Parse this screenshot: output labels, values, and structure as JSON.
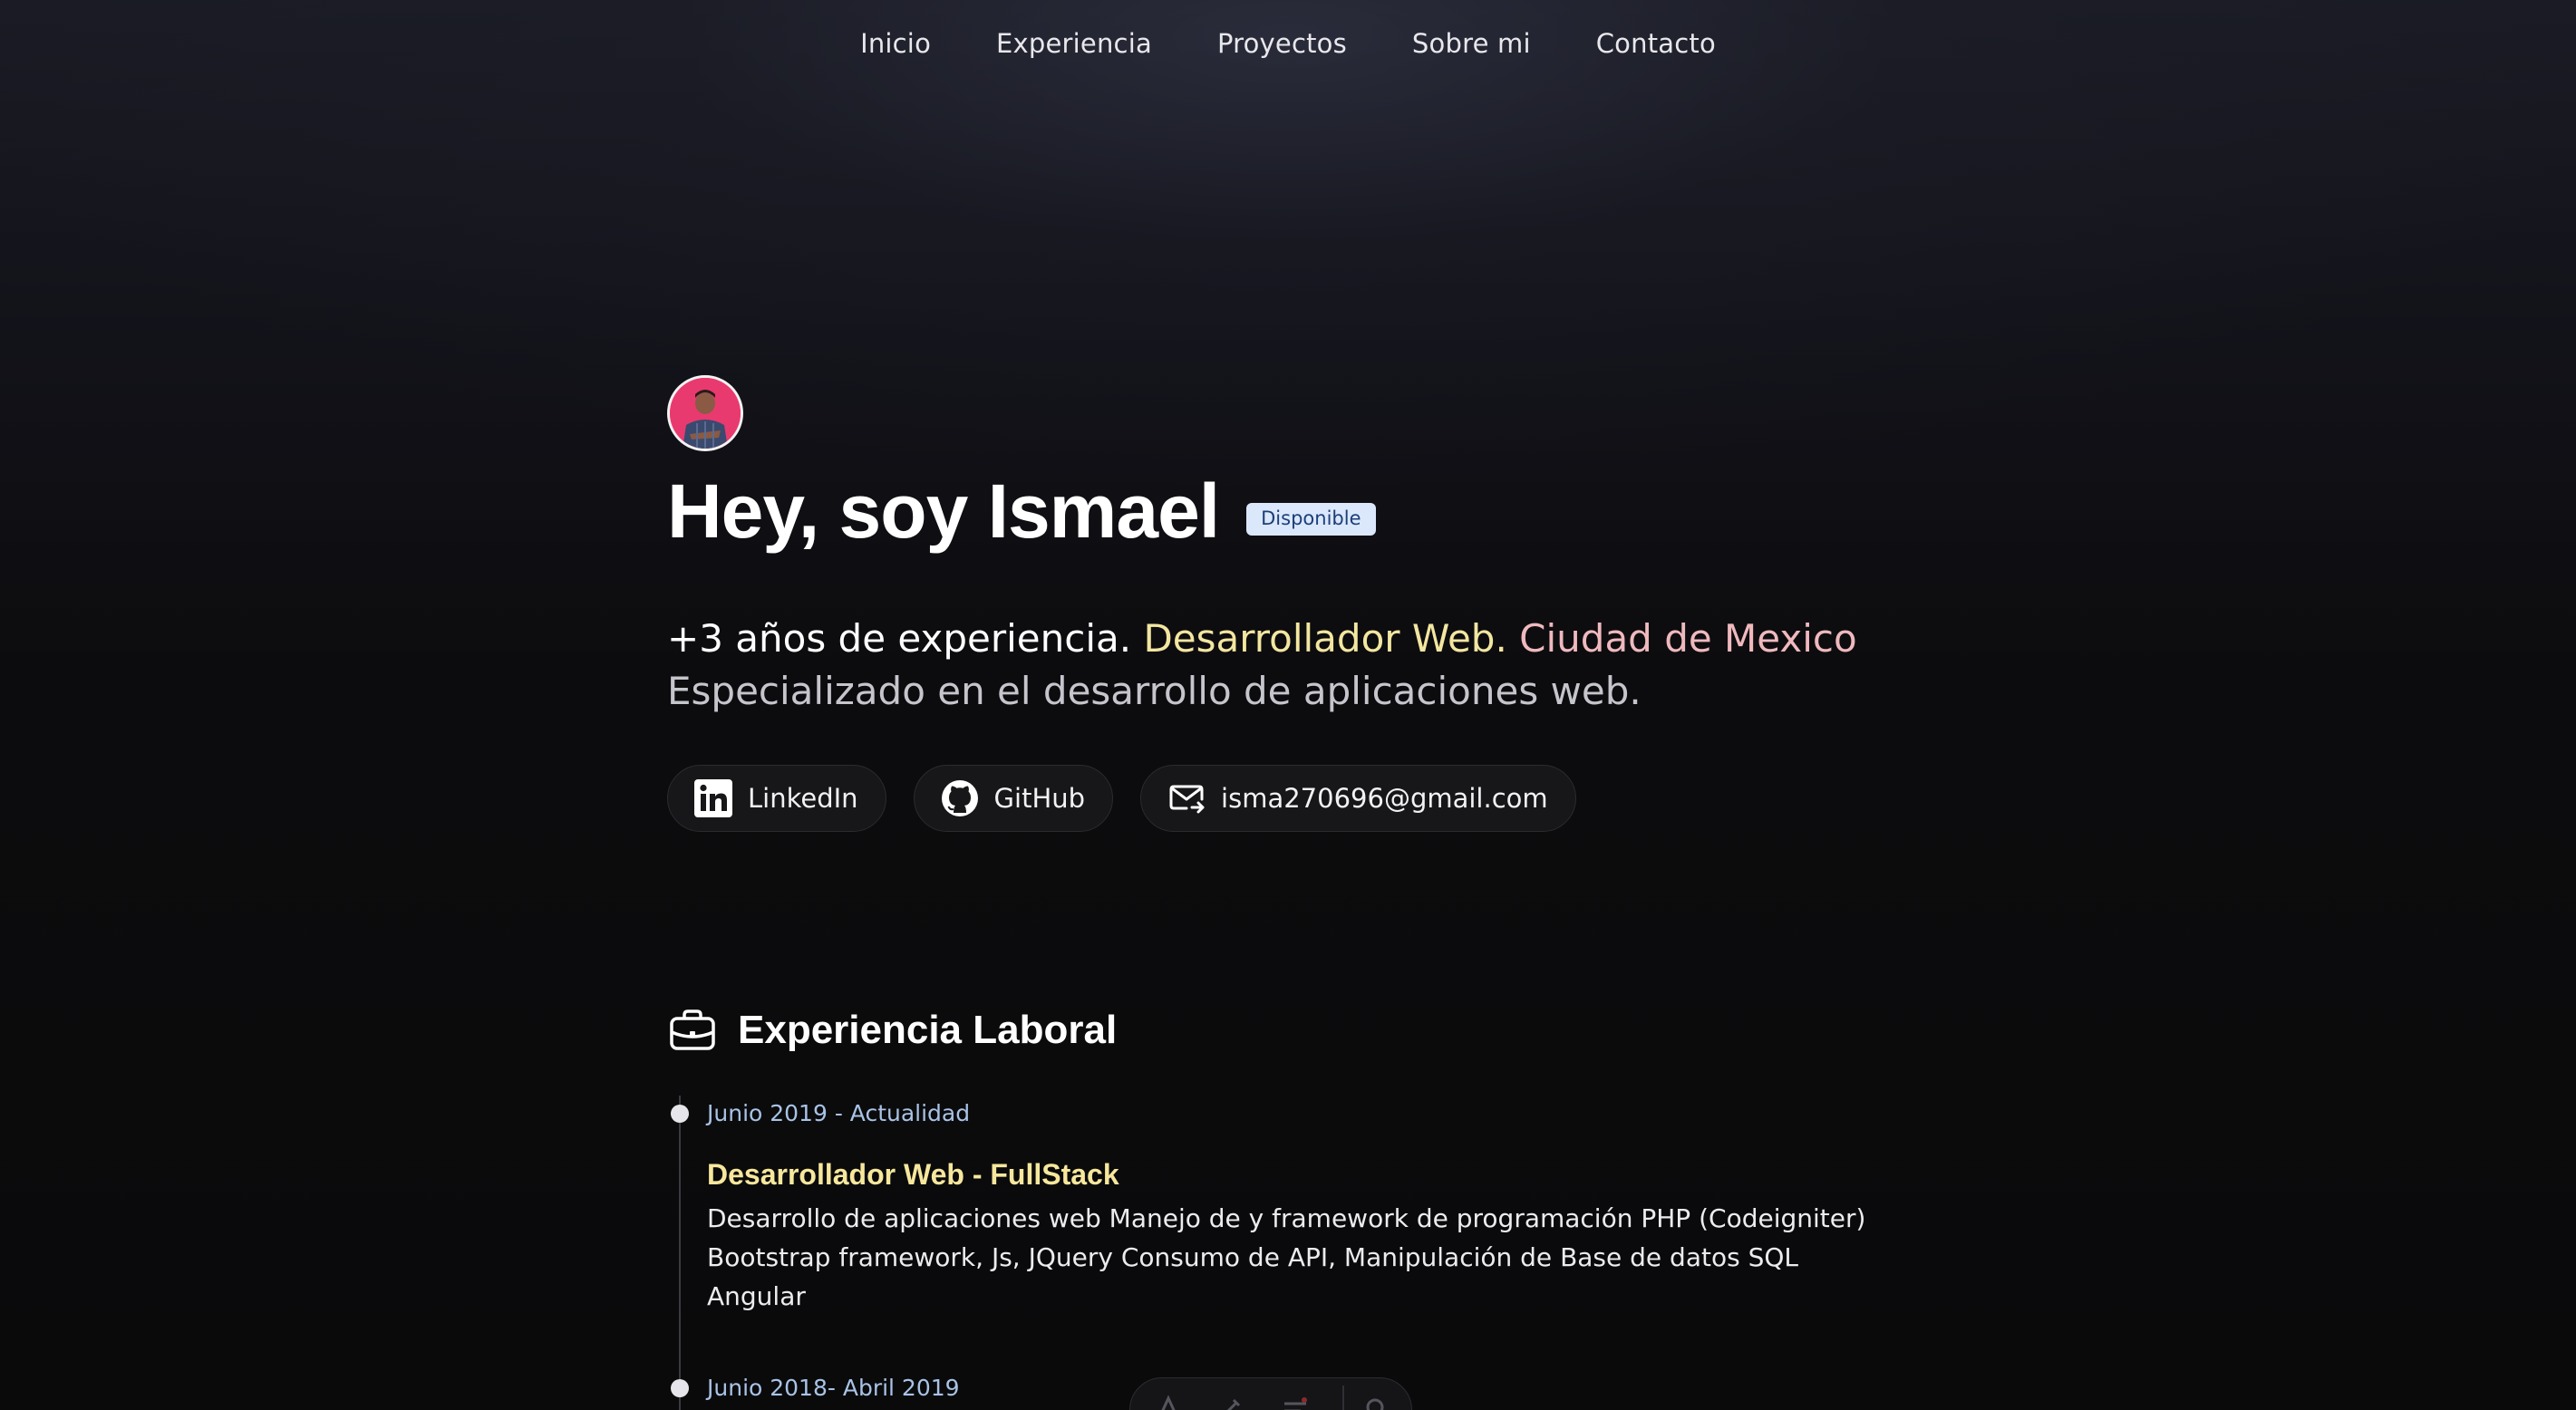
{
  "nav": {
    "items": [
      {
        "label": "Inicio"
      },
      {
        "label": "Experiencia"
      },
      {
        "label": "Proyectos"
      },
      {
        "label": "Sobre mi"
      },
      {
        "label": "Contacto"
      }
    ]
  },
  "hero": {
    "title": "Hey, soy Ismael",
    "badge": "Disponible",
    "tagline_experience": "+3 años de experiencia.",
    "tagline_role": "Desarrollador Web.",
    "tagline_location": "Ciudad de Mexico",
    "tagline_specialty": "Especializado en el desarrollo de aplicaciones web."
  },
  "social": {
    "linkedin_label": "LinkedIn",
    "github_label": "GitHub",
    "email_label": "isma270696@gmail.com"
  },
  "experience": {
    "heading": "Experiencia Laboral",
    "items": [
      {
        "date": "Junio 2019 - Actualidad",
        "role": "Desarrollador Web - FullStack",
        "description": "Desarrollo de aplicaciones web Manejo de y framework de programación PHP (Codeigniter) Bootstrap framework, Js, JQuery Consumo de API, Manipulación de Base de datos SQL Angular"
      },
      {
        "date": "Junio 2018- Abril 2019"
      }
    ]
  },
  "icons": {
    "linkedin": "linkedin-icon",
    "github": "github-icon",
    "email": "mail-icon",
    "experience": "briefcase-icon"
  },
  "colors": {
    "accent_yellow": "#f3e6a0",
    "accent_pink": "#efb9be",
    "badge_bg": "#dbe8fb",
    "badge_text": "#1d3f78",
    "date_text": "#a9c3e6"
  }
}
